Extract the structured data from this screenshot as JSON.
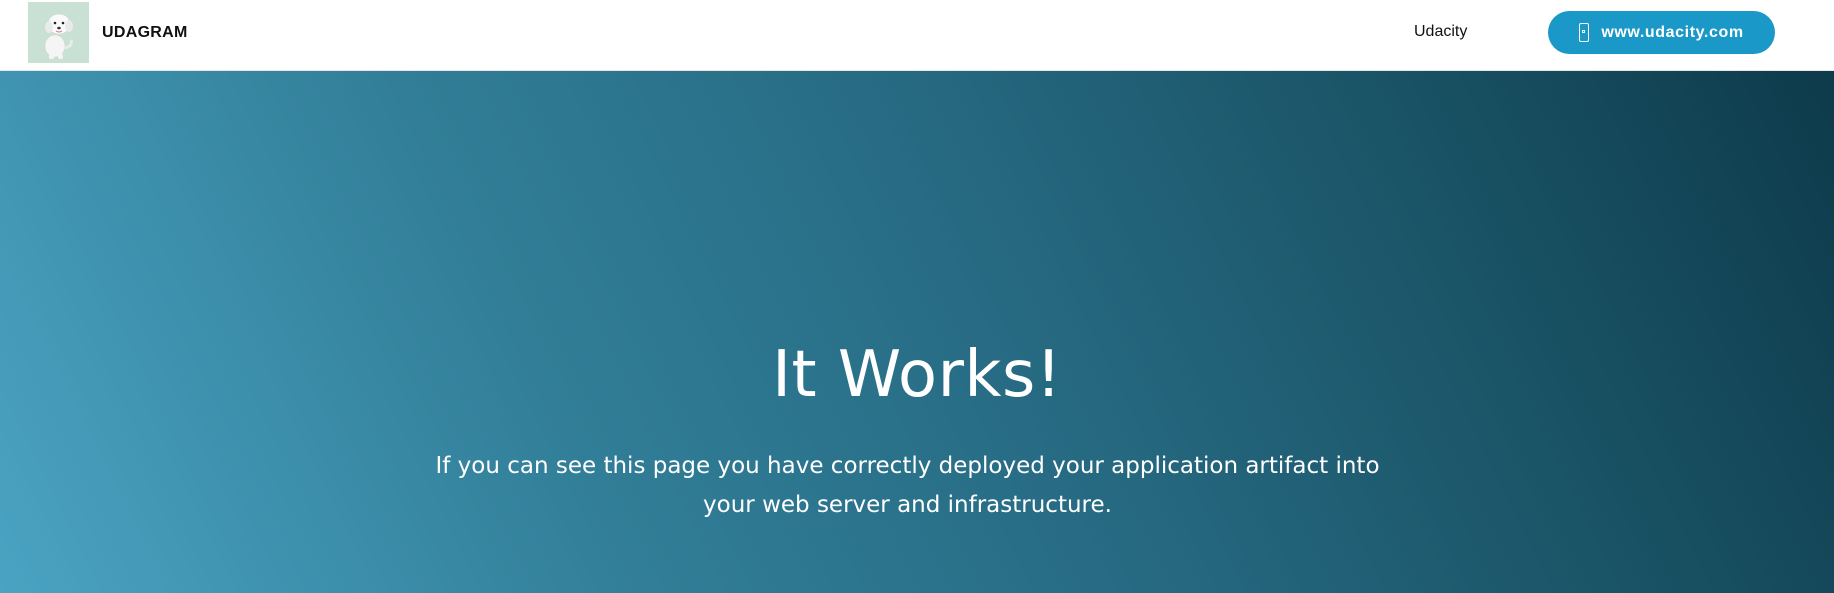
{
  "navbar": {
    "brand": {
      "name": "UDAGRAM",
      "logo_icon": "puppy-logo"
    },
    "links": [
      {
        "label": "Udacity"
      }
    ],
    "cta_button": {
      "label": "www.udacity.com",
      "icon": "phone-icon",
      "color": "#1a98c8"
    }
  },
  "hero": {
    "title": "It Works!",
    "subtitle": "If you can see this page you have correctly deployed your application artifact into your web server and infrastructure.",
    "gradient_colors": [
      "#4aa3c2",
      "#0d3b4b"
    ]
  }
}
